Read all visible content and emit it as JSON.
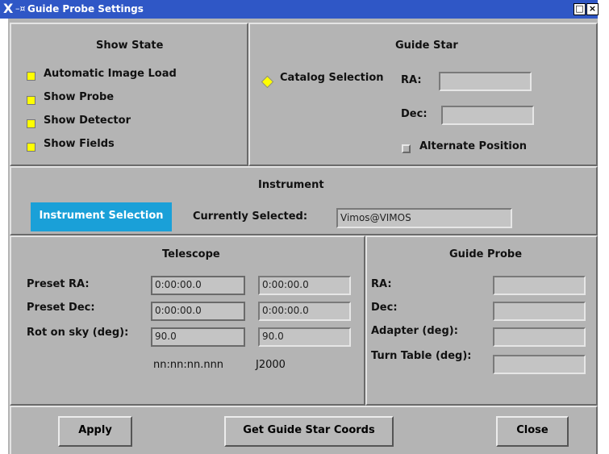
{
  "window": {
    "title": "Guide Probe Settings",
    "buttons": [
      "□",
      "×"
    ]
  },
  "show_state": {
    "header": "Show State",
    "items": [
      {
        "label": "Automatic Image Load",
        "checked": true
      },
      {
        "label": "Show Probe",
        "checked": true
      },
      {
        "label": "Show Detector",
        "checked": true
      },
      {
        "label": "Show Fields",
        "checked": true
      }
    ]
  },
  "guide_star": {
    "header": "Guide Star",
    "catalog_label": "Catalog Selection",
    "ra_label": "RA:",
    "ra_value": "",
    "dec_label": "Dec:",
    "dec_value": "",
    "alt_label": "Alternate Position",
    "alt_checked": false
  },
  "instrument": {
    "header": "Instrument",
    "selection_button": "Instrument Selection",
    "current_label": "Currently Selected:",
    "current_value": "Vimos@VIMOS"
  },
  "telescope": {
    "header": "Telescope",
    "rows": [
      {
        "label": "Preset RA:",
        "value1": "0:00:00.0",
        "value2": "0:00:00.0"
      },
      {
        "label": "Preset Dec:",
        "value1": "0:00:00.0",
        "value2": "0:00:00.0"
      },
      {
        "label": "Rot on sky (deg):",
        "value1": "90.0",
        "value2": "90.0"
      }
    ],
    "format_note": "nn:nn:nn.nnn",
    "epoch_note": "J2000"
  },
  "guide_probe": {
    "header": "Guide Probe",
    "rows": [
      {
        "label": "RA:",
        "value": ""
      },
      {
        "label": "Dec:",
        "value": ""
      },
      {
        "label": "Adapter (deg):",
        "value": ""
      },
      {
        "label": "Turn Table (deg):",
        "value": ""
      }
    ]
  },
  "footer": {
    "apply": "Apply",
    "get_coords": "Get Guide Star Coords",
    "close": "Close"
  }
}
